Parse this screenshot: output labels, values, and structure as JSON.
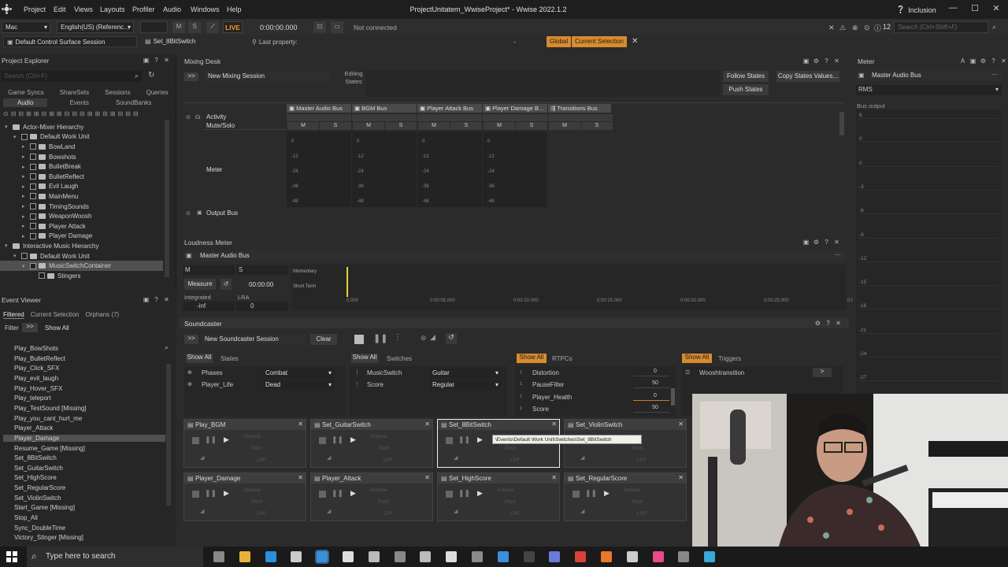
{
  "menubar": {
    "items": [
      "Project",
      "Edit",
      "Views",
      "Layouts",
      "Profiler",
      "Audio",
      "Windows",
      "Help"
    ],
    "title": "ProjectUnitatem_WwiseProject* - Wwise 2022.1.2",
    "user": "Inclusion"
  },
  "toolbar": {
    "platform": "Mac",
    "language": "English(US) (Referenc...",
    "mute": "M",
    "solo": "S",
    "live": "LIVE",
    "timecode": "0:00:00.000",
    "connection": "Not connected",
    "notifications": "12",
    "search_placeholder": "Search (Ctrl+Shift+F)"
  },
  "toolbar2": {
    "session": "Default Control Surface Session",
    "selected_object": "Set_8BitSwitch",
    "last_property": "Last property:",
    "dash": "-",
    "global": "Global",
    "current_selection": "Current Selection"
  },
  "project_explorer": {
    "title": "Project Explorer",
    "search_placeholder": "Search (Ctrl+F)",
    "tabs_row1": [
      "Game Syncs",
      "ShareSets",
      "Sessions",
      "Queries"
    ],
    "tabs_row2": [
      "Audio",
      "Events",
      "SoundBanks"
    ],
    "tree": [
      {
        "label": "Actor-Mixer Hierarchy",
        "depth": 0
      },
      {
        "label": "Default Work Unit",
        "depth": 1
      },
      {
        "label": "BowLand",
        "depth": 2
      },
      {
        "label": "Bowshots",
        "depth": 2
      },
      {
        "label": "BulletBreak",
        "depth": 2
      },
      {
        "label": "BulletReflect",
        "depth": 2
      },
      {
        "label": "Evil Laugh",
        "depth": 2
      },
      {
        "label": "MainMenu",
        "depth": 2
      },
      {
        "label": "TimingSounds",
        "depth": 2
      },
      {
        "label": "WeaponWoosh",
        "depth": 2
      },
      {
        "label": "Player Attack",
        "depth": 2
      },
      {
        "label": "Player Damage",
        "depth": 2
      },
      {
        "label": "Interactive Music Hierarchy",
        "depth": 0
      },
      {
        "label": "Default Work Unit",
        "depth": 1
      },
      {
        "label": "MusicSwitchContainer",
        "depth": 2
      },
      {
        "label": "Stingers",
        "depth": 3
      }
    ]
  },
  "event_viewer": {
    "title": "Event Viewer",
    "tabs": [
      "Filtered",
      "Current Selection",
      "Orphans (7)"
    ],
    "filter_label": "Filter",
    "filter_value": "Show All",
    "events": [
      "Play_BowShots",
      "Play_BulletReflect",
      "Play_Click_SFX",
      "Play_evil_laugh",
      "Play_Hover_SFX",
      "Play_teleport",
      "Play_TestSound [Missing]",
      "Play_you_cant_hurt_me",
      "Player_Attack",
      "Player_Damage",
      "Resume_Game [Missing]",
      "Set_8BitSwitch",
      "Set_GuitarSwitch",
      "Set_HighScore",
      "Set_RegularScore",
      "Set_ViolinSwitch",
      "Start_Game [Missing]",
      "Stop_All",
      "Sync_DoubleTime",
      "Victory_Stinger [Missing]"
    ],
    "selected_index": 9
  },
  "mixing_desk": {
    "title": "Mixing Desk",
    "session": "New Mixing Session",
    "editing_states": "Editing States",
    "follow_states": "Follow States",
    "copy_states": "Copy States Values...",
    "push_states": "Push States",
    "buses": [
      "Master Audio Bus",
      "BGM Bus",
      "Player Attack Bus",
      "Player Damage B...",
      "Transitions Bus"
    ],
    "rows": {
      "activity": "Activity",
      "mutesolo": "Mute/Solo",
      "meter": "Meter",
      "output": "Output Bus"
    },
    "scale": [
      "0",
      "-12",
      "-24",
      "-36",
      "-48"
    ]
  },
  "loudness": {
    "title": "Loudness Meter",
    "bus": "Master Audio Bus",
    "mute": "M",
    "solo": "S",
    "measure": "Measure",
    "time": "00:00:00",
    "integrated_label": "Integrated",
    "lra_label": "LRA",
    "integrated_value": "-inf",
    "lra_value": "0",
    "momentary": "Momentary",
    "short_term": "Short Term",
    "timeline": [
      "0.000",
      "0:00:05.000",
      "0:00:10.000",
      "0:00:15.000",
      "0:00:20.000",
      "0:00:25.000",
      "0:00:3"
    ]
  },
  "soundcaster": {
    "title": "Soundcaster",
    "session": "New Soundcaster Session",
    "clear": "Clear",
    "states_panel": {
      "show_all": "Show All",
      "tab": "States",
      "rows": [
        {
          "name": "Phases",
          "value": "Combat"
        },
        {
          "name": "Player_Life",
          "value": "Dead"
        }
      ]
    },
    "switches_panel": {
      "show_all": "Show All",
      "tab": "Switches",
      "rows": [
        {
          "name": "MusicSwitch",
          "value": "Guitar"
        },
        {
          "name": "Score",
          "value": "Regular"
        }
      ]
    },
    "rtpc_panel": {
      "show_all": "Show All",
      "tab": "RTPCs",
      "rows": [
        {
          "name": "Distortion",
          "value": "0"
        },
        {
          "name": "PauseFilter",
          "value": "50"
        },
        {
          "name": "Player_Health",
          "value": "0"
        },
        {
          "name": "Score",
          "value": "50"
        }
      ]
    },
    "triggers_panel": {
      "show_all": "Show All",
      "tab": "Triggers",
      "rows": [
        "Wooshtransition"
      ]
    },
    "cards": [
      "Play_BGM",
      "Set_GuitarSwitch",
      "Set_8BitSwitch",
      "Set_ViolinSwitch",
      "Player_Damage",
      "Player_Attack",
      "Set_HighScore",
      "Set_RegularScore"
    ],
    "card_labels": {
      "volume": "Volume",
      "pitch": "Pitch",
      "lpf": "LPF"
    },
    "tooltip": "\\Events\\Default Work Unit\\Switches\\Set_8BitSwitch"
  },
  "meter": {
    "title": "Meter",
    "bus": "Master Audio Bus",
    "mode": "RMS",
    "output": "Bus output",
    "scale": [
      "6",
      "0",
      "0",
      "-3",
      "-6",
      "-9",
      "-12",
      "-15",
      "-18",
      "-21",
      "-24",
      "-27"
    ]
  },
  "taskbar": {
    "search": "Type here to search"
  },
  "colors": {
    "accent": "#d88b2f",
    "live": "#f29a2a",
    "bg": "#2b2b2b"
  }
}
